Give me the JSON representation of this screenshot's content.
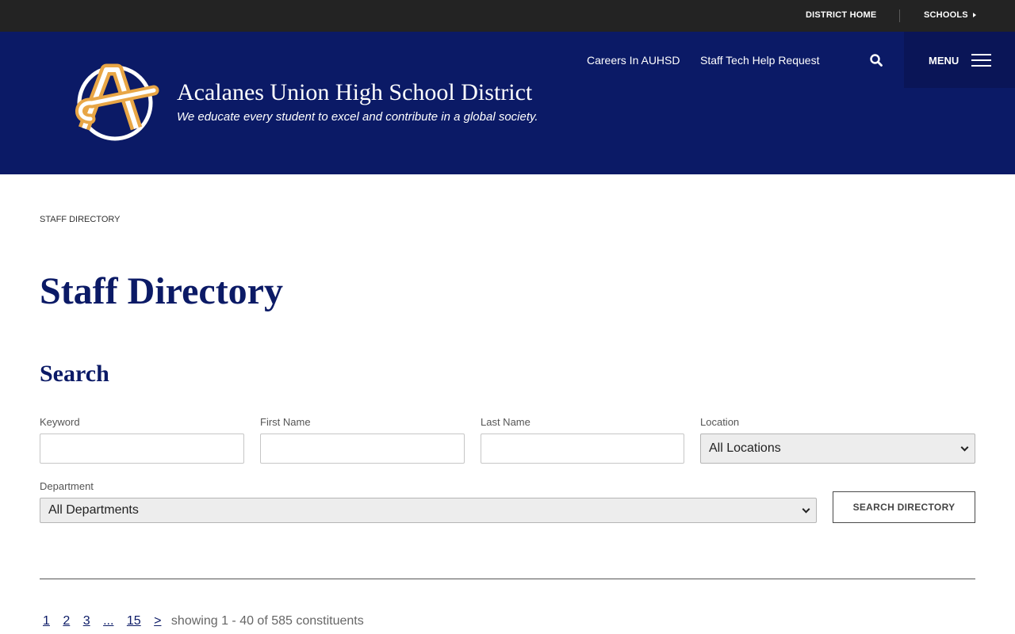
{
  "topbar": {
    "district_home": "DISTRICT HOME",
    "schools": "SCHOOLS"
  },
  "header": {
    "site_title": "Acalanes Union High School District",
    "tagline": "We educate every student to excel and contribute in a global society.",
    "links": [
      "Careers In AUHSD",
      "Staff Tech Help Request"
    ],
    "menu_label": "MENU"
  },
  "breadcrumb": "STAFF DIRECTORY",
  "page_title": "Staff Directory",
  "search": {
    "heading": "Search",
    "keyword_label": "Keyword",
    "keyword_value": "",
    "first_name_label": "First Name",
    "first_name_value": "",
    "last_name_label": "Last Name",
    "last_name_value": "",
    "location_label": "Location",
    "location_value": "All Locations",
    "department_label": "Department",
    "department_value": "All Departments",
    "submit_label": "SEARCH DIRECTORY"
  },
  "pagination": {
    "pages": [
      "1",
      "2",
      "3",
      "...",
      "15",
      ">"
    ],
    "summary": "showing 1 - 40 of 585 constituents"
  },
  "colors": {
    "brand_navy": "#0b1a66",
    "logo_gold": "#e8a646",
    "topbar": "#232323"
  },
  "icons": {
    "logo": "auhsd-a-logo",
    "search": "search-icon",
    "menu": "hamburger-icon",
    "caret": "caret-right-icon"
  }
}
